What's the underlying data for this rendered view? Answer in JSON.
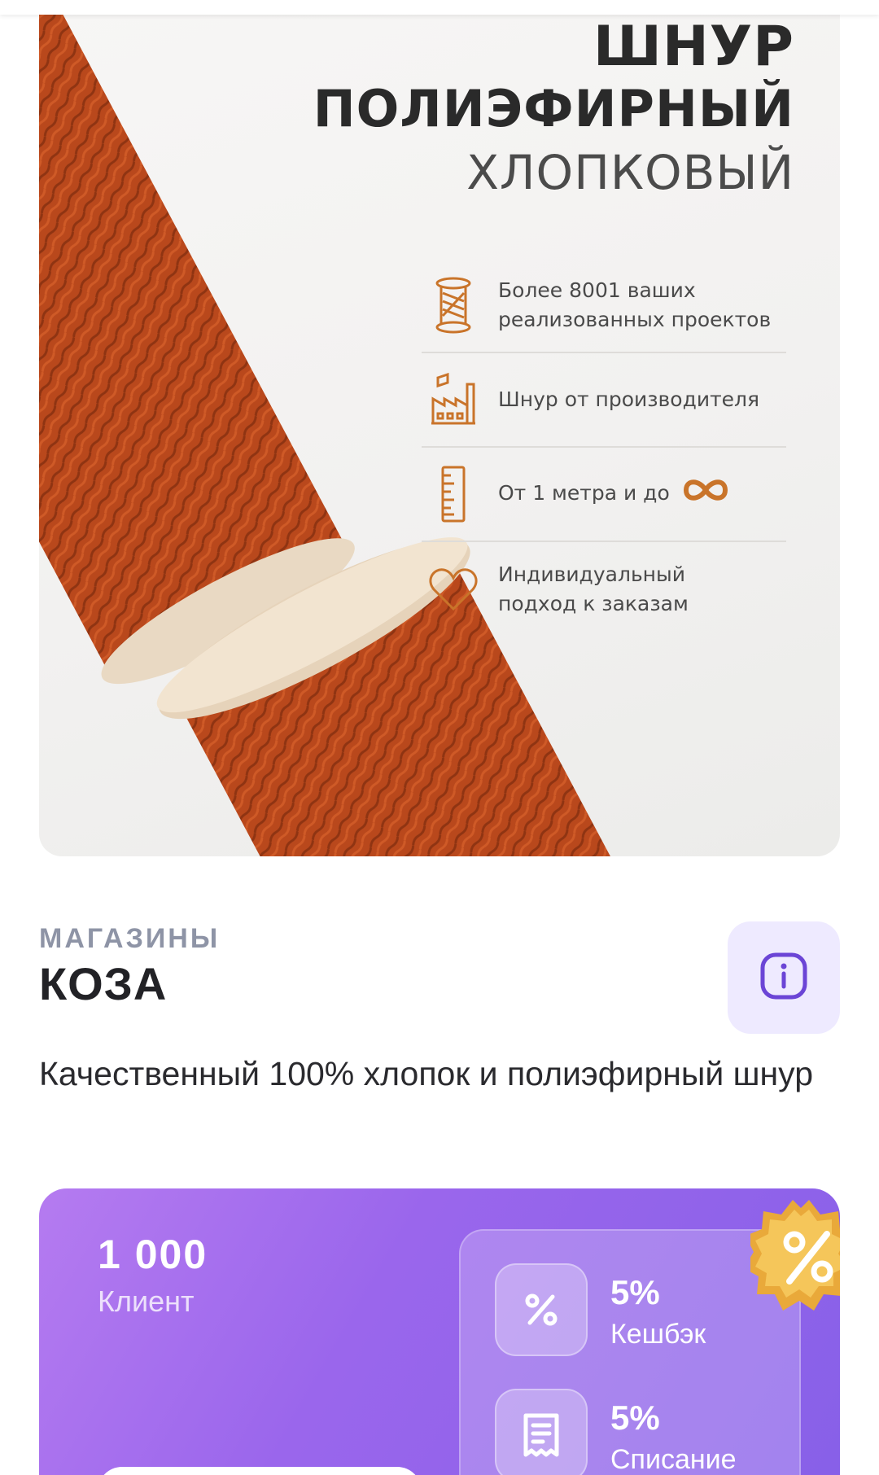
{
  "banner": {
    "headline": [
      "ШНУР",
      "ПОЛИЭФИРНЫЙ",
      "ХЛОПКОВЫЙ"
    ],
    "features": [
      {
        "icon": "spool-icon",
        "text": "Более 8001 ваших реализованных проектов"
      },
      {
        "icon": "factory-icon",
        "text": "Шнур от производителя"
      },
      {
        "icon": "ruler-icon",
        "text": "От 1 метра и до"
      },
      {
        "icon": "heart-icon",
        "text": "Индивидуальный подход к заказам"
      }
    ]
  },
  "shop": {
    "label": "МАГАЗИНЫ",
    "name": "КОЗА",
    "info_icon": "info-icon",
    "description": "Качественный 100% хлопок и полиэфирный шнур"
  },
  "loyalty": {
    "count": "1 000",
    "client_label": "Клиент",
    "perks": [
      {
        "icon": "percent-icon",
        "value": "5%",
        "label": "Кешбэк"
      },
      {
        "icon": "receipt-icon",
        "value": "5%",
        "label": "Списание"
      }
    ],
    "badge_icon": "discount-badge-icon"
  },
  "colors": {
    "accent_orange": "#c9742a",
    "card_gradient_start": "#b57bf0",
    "card_gradient_end": "#8760e8",
    "info_button_bg": "#eeeaff",
    "info_icon_color": "#6b45d6"
  }
}
